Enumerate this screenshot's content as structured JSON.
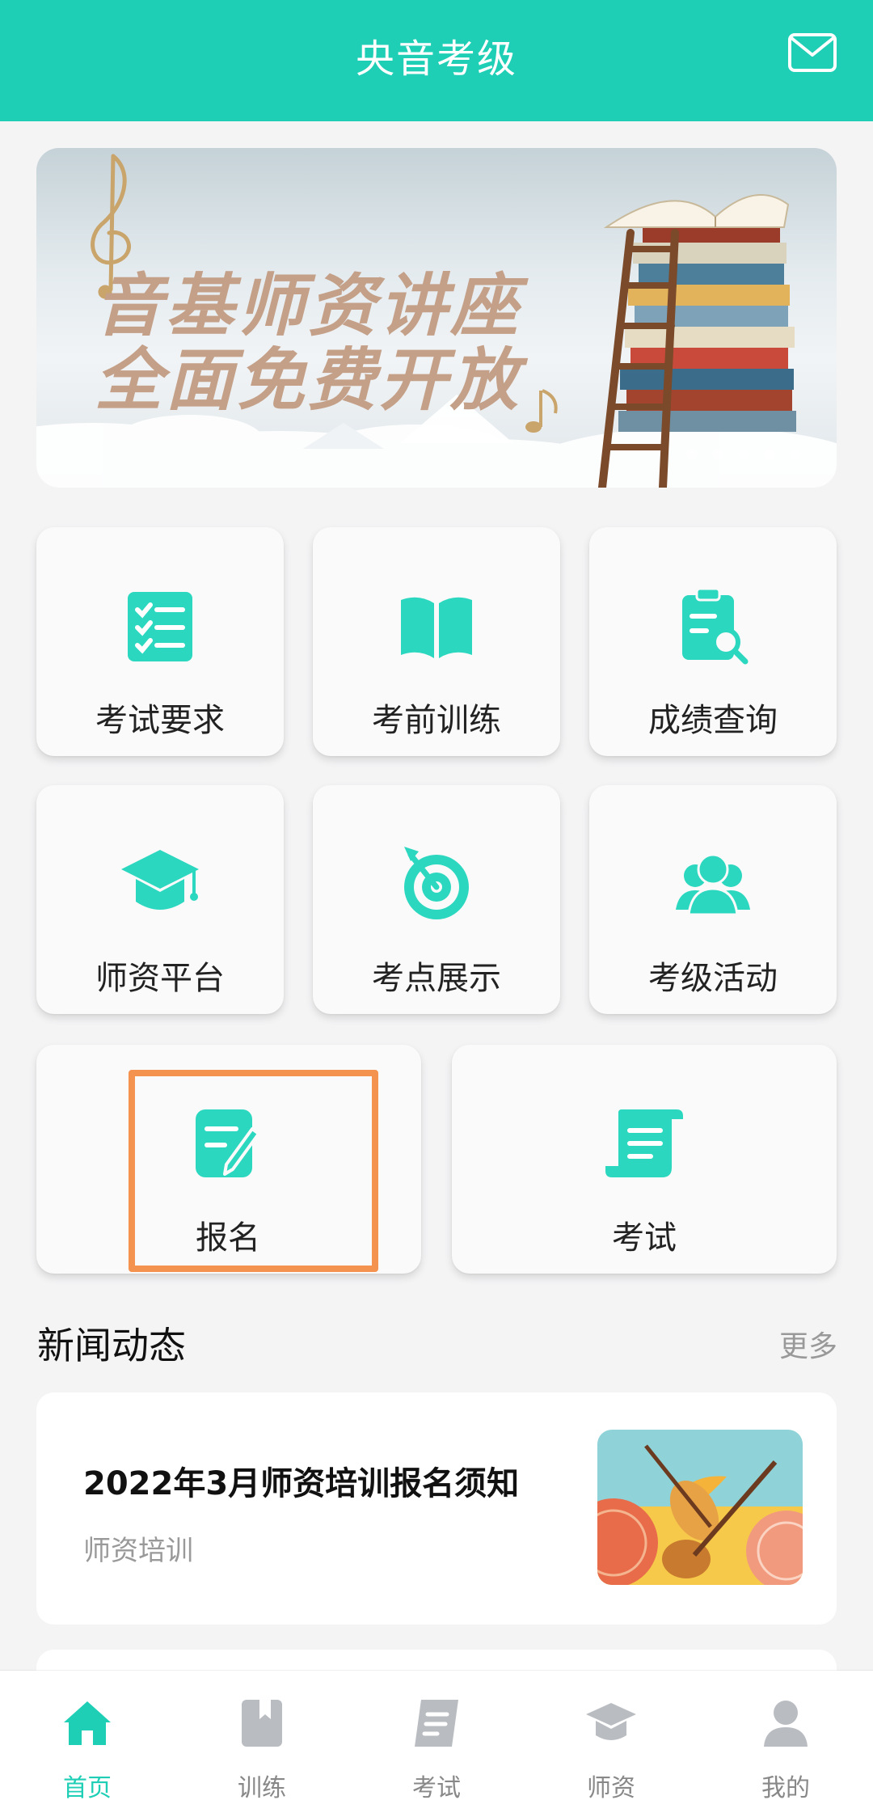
{
  "header": {
    "title": "央音考级",
    "mail_icon": "mail-icon"
  },
  "banner": {
    "line1": "音基师资讲座",
    "line2": "全面免费开放",
    "slide_count": 5,
    "active_slide": 4
  },
  "tiles": [
    {
      "id": "exam-requirements",
      "label": "考试要求",
      "icon": "checklist-icon"
    },
    {
      "id": "pre-exam-training",
      "label": "考前训练",
      "icon": "open-book-icon"
    },
    {
      "id": "score-query",
      "label": "成绩查询",
      "icon": "clipboard-search-icon"
    },
    {
      "id": "teacher-platform",
      "label": "师资平台",
      "icon": "graduation-cap-icon"
    },
    {
      "id": "exam-venues",
      "label": "考点展示",
      "icon": "target-icon"
    },
    {
      "id": "exam-activities",
      "label": "考级活动",
      "icon": "people-icon"
    },
    {
      "id": "register",
      "label": "报名",
      "icon": "edit-document-icon"
    },
    {
      "id": "exam",
      "label": "考试",
      "icon": "scroll-icon"
    }
  ],
  "news": {
    "title": "新闻动态",
    "more": "更多",
    "items": [
      {
        "title": "2022年3月师资培训报名须知",
        "tag": "师资培训",
        "thumb_icon": "violin-guitar-illustration"
      }
    ]
  },
  "nav": [
    {
      "label": "首页",
      "icon": "home-icon",
      "active": true
    },
    {
      "label": "训练",
      "icon": "book-icon",
      "active": false
    },
    {
      "label": "考试",
      "icon": "document-icon",
      "active": false
    },
    {
      "label": "师资",
      "icon": "graduation-cap-icon",
      "active": false
    },
    {
      "label": "我的",
      "icon": "user-icon",
      "active": false
    }
  ],
  "colors": {
    "accent": "#1ecfb6",
    "highlight": "#f4924f",
    "banner_text": "#c4a088"
  }
}
